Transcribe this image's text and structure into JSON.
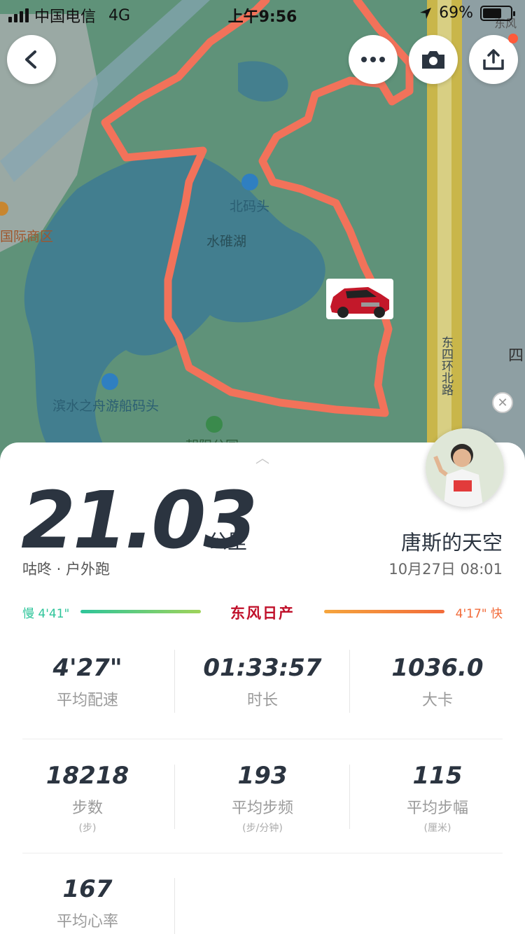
{
  "status_bar": {
    "carrier": "中国电信",
    "network": "4G",
    "time": "上午9:56",
    "battery_text": "69%",
    "battery_level": 0.69
  },
  "map": {
    "labels": {
      "pier_north": "北码头",
      "lake": "水碓湖",
      "pier_boat": "滨水之舟游船码头",
      "intl_district": "国际商区",
      "park": "朝阳公园",
      "road": "东四环北路",
      "edge_char": "四",
      "top_right": "东风"
    },
    "route_color": "#f2725a"
  },
  "toolbar": {
    "back_icon": "chevron-left-icon",
    "more_icon": "ellipsis-icon",
    "camera_icon": "camera-icon",
    "share_icon": "share-icon"
  },
  "summary": {
    "distance": "21.03",
    "distance_unit": "公里",
    "run_type": "咕咚 · 户外跑",
    "user_name": "唐斯的天空",
    "datetime": "10月27日 08:01"
  },
  "pace_bar": {
    "slow_label": "慢 4'41\"",
    "fast_label": "4'17\" 快",
    "brand": "东风日产",
    "slow_color": "#2ec59a",
    "fast_color": "#f26b3a"
  },
  "stats": [
    {
      "value": "4'27\"",
      "label": "平均配速",
      "sub": ""
    },
    {
      "value": "01:33:57",
      "label": "时长",
      "sub": ""
    },
    {
      "value": "1036.0",
      "label": "大卡",
      "sub": ""
    },
    {
      "value": "18218",
      "label": "步数",
      "sub": "(步)"
    },
    {
      "value": "193",
      "label": "平均步频",
      "sub": "(步/分钟)"
    },
    {
      "value": "115",
      "label": "平均步幅",
      "sub": "(厘米)"
    },
    {
      "value": "167",
      "label": "平均心率",
      "sub": ""
    }
  ]
}
